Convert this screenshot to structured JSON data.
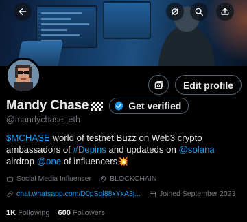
{
  "header": {
    "back_icon": "arrow-left-icon",
    "actions": [
      "disconnect-icon",
      "search-icon",
      "share-icon"
    ]
  },
  "profile": {
    "name": "Mandy Chase",
    "name_emoji": "🏁",
    "handle": "@mandychase_eth",
    "verify_label": "Get verified",
    "edit_label": "Edit profile"
  },
  "bio": {
    "p1": "$MCHASE",
    "p2": " world of testnet Buzz on Web3 crypto ambassadors of ",
    "p3": "#Depins",
    "p4": " and updateds on ",
    "p5": "@solana",
    "p6": " airdrop ",
    "p7": "@one",
    "p8": " of influencers",
    "p9": "💥"
  },
  "meta": {
    "category": "Social Media Influencer",
    "location": "BLOCKCHAIN",
    "link": "chat.whatsapp.com/D0pSql88xYxA3j...",
    "joined": "Joined September 2023"
  },
  "stats": {
    "following_count": "1K",
    "following_label": "Following",
    "followers_count": "600",
    "followers_label": "Followers"
  },
  "colors": {
    "accent": "#1d9bf0",
    "muted": "#71767b",
    "text": "#e7e9ea",
    "background": "#000000"
  }
}
